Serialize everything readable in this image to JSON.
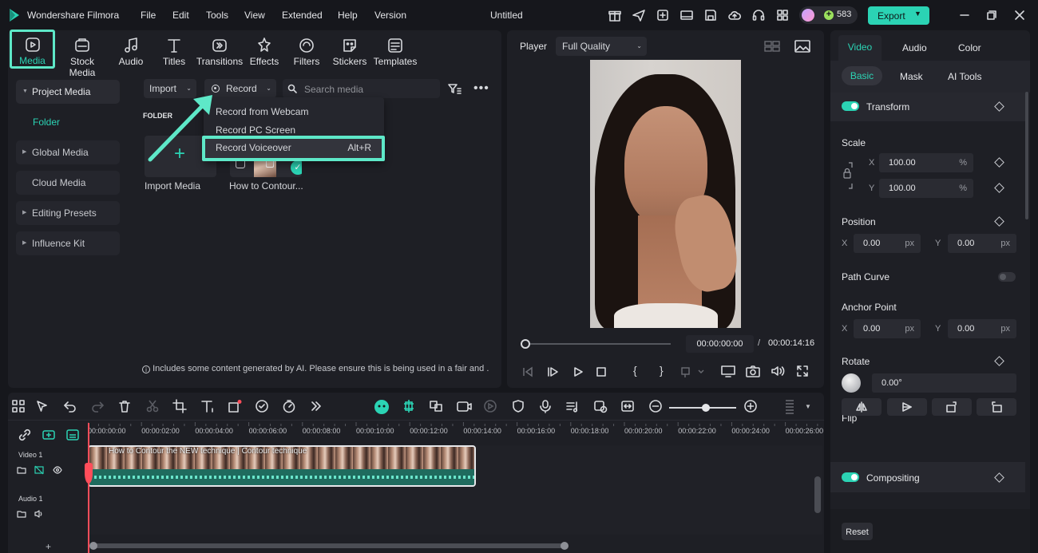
{
  "app": {
    "name": "Wondershare Filmora",
    "project_title": "Untitled",
    "credits": "583",
    "export_label": "Export"
  },
  "menu": [
    "File",
    "Edit",
    "Tools",
    "View",
    "Extended",
    "Help",
    "Version"
  ],
  "toolbar_tabs": [
    "Media",
    "Stock Media",
    "Audio",
    "Titles",
    "Transitions",
    "Effects",
    "Filters",
    "Stickers",
    "Templates"
  ],
  "sidebar": {
    "project_media": "Project Media",
    "folder": "Folder",
    "global_media": "Global Media",
    "cloud_media": "Cloud Media",
    "editing_presets": "Editing Presets",
    "influence_kit": "Influence Kit"
  },
  "media": {
    "import_label": "Import",
    "record_label": "Record",
    "search_placeholder": "Search media",
    "folder_heading": "FOLDER",
    "import_tile_label": "Import Media",
    "clip_label": "How to Contour...",
    "notice": "Includes some content generated by AI. Please ensure this is being used in a fair and ."
  },
  "record_menu": {
    "webcam": "Record from Webcam",
    "screen": "Record PC Screen",
    "voiceover": "Record Voiceover",
    "voiceover_shortcut": "Alt+R"
  },
  "player": {
    "label": "Player",
    "quality": "Full Quality",
    "current_time": "00:00:00:00",
    "separator": "/",
    "total_time": "00:00:14:16"
  },
  "properties": {
    "tabs": [
      "Video",
      "Audio",
      "Color"
    ],
    "subtabs": [
      "Basic",
      "Mask",
      "AI Tools"
    ],
    "transform": "Transform",
    "scale": "Scale",
    "scale_x": "100.00",
    "scale_y": "100.00",
    "percent": "%",
    "position": "Position",
    "pos_x": "0.00",
    "pos_y": "0.00",
    "px": "px",
    "path_curve": "Path Curve",
    "anchor_point": "Anchor Point",
    "anchor_x": "0.00",
    "anchor_y": "0.00",
    "rotate": "Rotate",
    "rotate_value": "0.00°",
    "flip": "Flip",
    "compositing": "Compositing",
    "reset": "Reset",
    "x": "X",
    "y": "Y"
  },
  "timeline": {
    "ticks": [
      "00:00:00:00",
      "00:00:02:00",
      "00:00:04:00",
      "00:00:06:00",
      "00:00:08:00",
      "00:00:10:00",
      "00:00:12:00",
      "00:00:14:00",
      "00:00:16:00",
      "00:00:18:00",
      "00:00:20:00",
      "00:00:22:00",
      "00:00:24:00",
      "00:00:26:00"
    ],
    "video_track": "Video 1",
    "audio_track": "Audio 1",
    "clip_title": "How to Contour the NEW technique | Contour technique"
  },
  "colors": {
    "accent": "#2bd3b4",
    "export": "#2bd3b4",
    "highlight_box": "#5ee8c8",
    "playhead": "#ff4d5a"
  }
}
